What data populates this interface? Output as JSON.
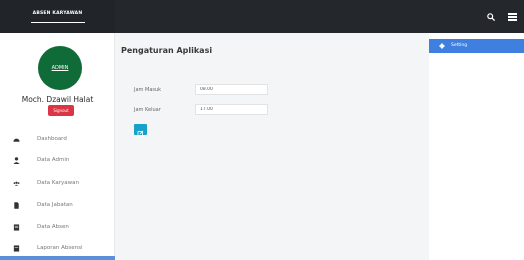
{
  "brand": {
    "title": "ABSEN KARYAWAN"
  },
  "profile": {
    "avatar_text": "ADMIN",
    "name": "Moch. Dzawil Halat",
    "signout_label": "Signout"
  },
  "sidebar": {
    "items": [
      {
        "label": "Dashboard",
        "icon": "tachometer-icon"
      },
      {
        "label": "Data Admin",
        "icon": "user-icon"
      },
      {
        "label": "Data Karyawan",
        "icon": "users-icon"
      },
      {
        "label": "Data Jabatan",
        "icon": "file-icon"
      },
      {
        "label": "Data Absen",
        "icon": "list-icon"
      },
      {
        "label": "Laporan Absensi",
        "icon": "report-icon"
      }
    ]
  },
  "main": {
    "title": "Pengaturan Aplikasi",
    "jam_masuk_label": "Jam Masuk",
    "jam_masuk_value": "08.00",
    "jam_keluar_label": "Jam Keluar",
    "jam_keluar_value": "17.00"
  },
  "right_panel": {
    "setting_label": "Setting"
  },
  "colors": {
    "topbar": "#24282d",
    "accent": "#3f7fe0",
    "danger": "#dc3545",
    "info": "#17a2c8",
    "avatar": "#0f6b37"
  }
}
